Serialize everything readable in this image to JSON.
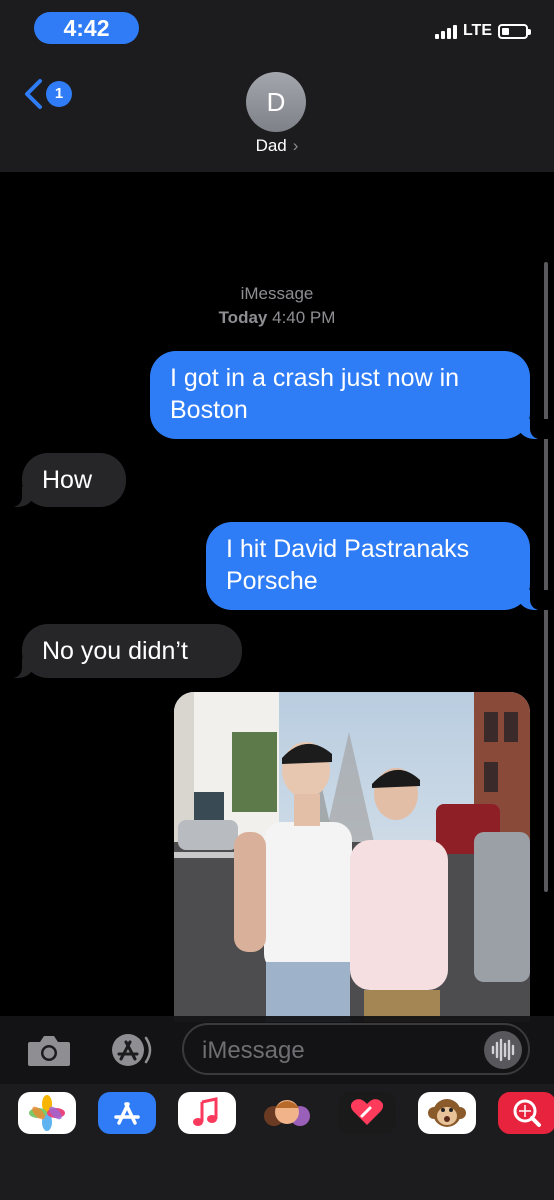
{
  "status_bar": {
    "time": "4:42",
    "network": "LTE"
  },
  "header": {
    "back_badge": "1",
    "avatar_initial": "D",
    "contact_name": "Dad",
    "contact_chevron": "›"
  },
  "conversation": {
    "service": "iMessage",
    "date_label": "Today",
    "time_label": "4:40 PM",
    "messages": [
      {
        "direction": "outgoing",
        "text": "I got in a crash just now in Boston"
      },
      {
        "direction": "incoming",
        "text": "How"
      },
      {
        "direction": "outgoing",
        "text": "I hit David Pastranaks Porsche"
      },
      {
        "direction": "incoming",
        "text": "No you didn’t"
      },
      {
        "direction": "outgoing",
        "type": "photo",
        "subject": "two-men-on-street-photo"
      }
    ]
  },
  "input": {
    "placeholder": "iMessage",
    "camera_icon": "camera-icon",
    "appstore_icon": "appstore-icon",
    "voice_icon": "audio-waveform-icon"
  },
  "app_drawer": {
    "apps": [
      "photos-icon",
      "appstore-icon",
      "music-icon",
      "memoji-icon",
      "digital-touch-icon",
      "animoji-icon",
      "web-search-icon"
    ]
  },
  "colors": {
    "accent": "#2f7cf6",
    "outgoing_bubble": "#2f7df6",
    "incoming_bubble": "#262628",
    "background": "#000000",
    "header_bg": "#1c1c1e"
  }
}
